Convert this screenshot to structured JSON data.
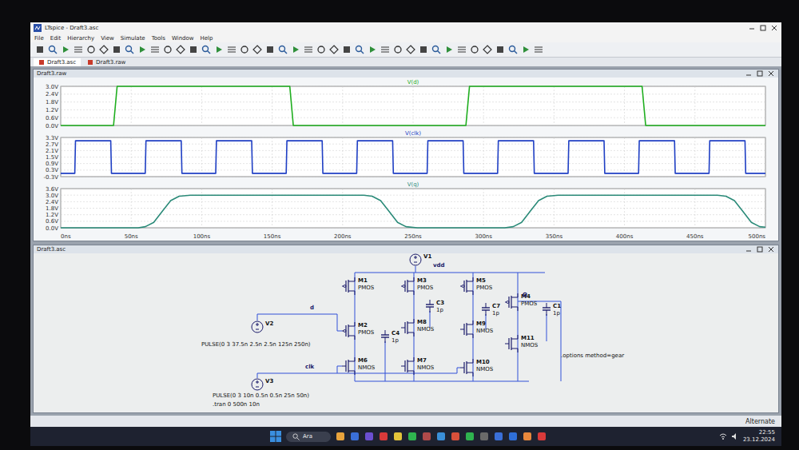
{
  "window": {
    "title": "LTspice - Draft3.asc"
  },
  "menu": [
    "File",
    "Edit",
    "Hierarchy",
    "View",
    "Simulate",
    "Tools",
    "Window",
    "Help"
  ],
  "tabs": [
    {
      "label": "Draft3.asc",
      "selected": true
    },
    {
      "label": "Draft3.raw",
      "selected": false
    }
  ],
  "waveform_window": {
    "title": "Draft3.raw",
    "x_ticks": [
      "0ns",
      "50ns",
      "100ns",
      "150ns",
      "200ns",
      "250ns",
      "300ns",
      "350ns",
      "400ns",
      "450ns",
      "500ns"
    ],
    "panes": [
      {
        "trace": "V(d)",
        "color": "#1fae1f",
        "y_ticks": [
          "3.0V",
          "2.4V",
          "1.8V",
          "1.2V",
          "0.6V",
          "0.0V"
        ],
        "t": [
          0,
          37.5,
          40,
          162.5,
          165,
          287.5,
          290,
          412.5,
          415,
          500
        ],
        "v": [
          0,
          0,
          3,
          3,
          0,
          0,
          3,
          3,
          0,
          0
        ]
      },
      {
        "trace": "V(clk)",
        "color": "#1f3fc4",
        "y_ticks": [
          "3.3V",
          "2.7V",
          "2.1V",
          "1.5V",
          "0.9V",
          "0.3V",
          "-0.3V"
        ],
        "t": [
          0,
          10,
          10.5,
          35.5,
          36,
          60,
          60.5,
          85.5,
          86,
          110,
          110.5,
          135.5,
          136,
          160,
          160.5,
          185.5,
          186,
          210,
          210.5,
          235.5,
          236,
          260,
          260.5,
          285.5,
          286,
          310,
          310.5,
          335.5,
          336,
          360,
          360.5,
          385.5,
          386,
          410,
          410.5,
          435.5,
          436,
          460,
          460.5,
          485.5,
          486,
          500
        ],
        "v": [
          0,
          0,
          3,
          3,
          0,
          0,
          3,
          3,
          0,
          0,
          3,
          3,
          0,
          0,
          3,
          3,
          0,
          0,
          3,
          3,
          0,
          0,
          3,
          3,
          0,
          0,
          3,
          3,
          0,
          0,
          3,
          3,
          0,
          0,
          3,
          3,
          0,
          0,
          3,
          3,
          0,
          0
        ]
      },
      {
        "trace": "V(q)",
        "color": "#2a8a78",
        "y_ticks": [
          "3.6V",
          "3.0V",
          "2.4V",
          "1.8V",
          "1.2V",
          "0.6V",
          "0.0V"
        ],
        "t": [
          0,
          55,
          60,
          66,
          72,
          78,
          84,
          92,
          215,
          221,
          227,
          233,
          239,
          245,
          253,
          315,
          321,
          327,
          333,
          339,
          345,
          353,
          466,
          472,
          478,
          484,
          490,
          496,
          500
        ],
        "v": [
          0,
          0,
          0.1,
          0.5,
          1.5,
          2.5,
          2.9,
          3,
          3,
          2.9,
          2.5,
          1.5,
          0.5,
          0.1,
          0,
          0,
          0.1,
          0.5,
          1.5,
          2.5,
          2.9,
          3,
          3,
          2.9,
          2.5,
          1.5,
          0.5,
          0.1,
          0.05
        ]
      }
    ]
  },
  "schematic_window": {
    "title": "Draft3.asc",
    "components": [
      {
        "ref": "M1",
        "kind": "pmos",
        "value": "PMOS"
      },
      {
        "ref": "M2",
        "kind": "pmos",
        "value": "PMOS"
      },
      {
        "ref": "M6",
        "kind": "nmos",
        "value": "NMOS"
      },
      {
        "ref": "M3",
        "kind": "pmos",
        "value": "PMOS"
      },
      {
        "ref": "M8",
        "kind": "nmos",
        "value": "NMOS"
      },
      {
        "ref": "M7",
        "kind": "nmos",
        "value": "NMOS"
      },
      {
        "ref": "M5",
        "kind": "pmos",
        "value": "PMOS"
      },
      {
        "ref": "M9",
        "kind": "nmos",
        "value": "NMOS"
      },
      {
        "ref": "M10",
        "kind": "nmos",
        "value": "NMOS"
      },
      {
        "ref": "M4",
        "kind": "pmos",
        "value": "PMOS"
      },
      {
        "ref": "M11",
        "kind": "nmos",
        "value": "NMOS"
      },
      {
        "ref": "C4",
        "kind": "capacitor",
        "value": "1p"
      },
      {
        "ref": "C3",
        "kind": "capacitor",
        "value": "1p"
      },
      {
        "ref": "C7",
        "kind": "capacitor",
        "value": "1p"
      },
      {
        "ref": "C1",
        "kind": "capacitor",
        "value": "1p"
      },
      {
        "ref": "V1",
        "kind": "source",
        "value": ""
      },
      {
        "ref": "V2",
        "kind": "source",
        "value": "PULSE(0 3 37.5n 2.5n 2.5n 125n 250n)"
      },
      {
        "ref": "V3",
        "kind": "source",
        "value": "PULSE(0 3 10n 0.5n 0.5n 25n 50n)"
      }
    ],
    "net_labels": [
      "vdd",
      "d",
      "Q",
      "clk"
    ],
    "directives": [
      ".options method=gear",
      ".tran 0 500n 10n"
    ]
  },
  "status_bar": {
    "mode": "Alternate"
  },
  "taskbar": {
    "search": "Ara",
    "time": "22:55",
    "date": "23.12.2024"
  }
}
